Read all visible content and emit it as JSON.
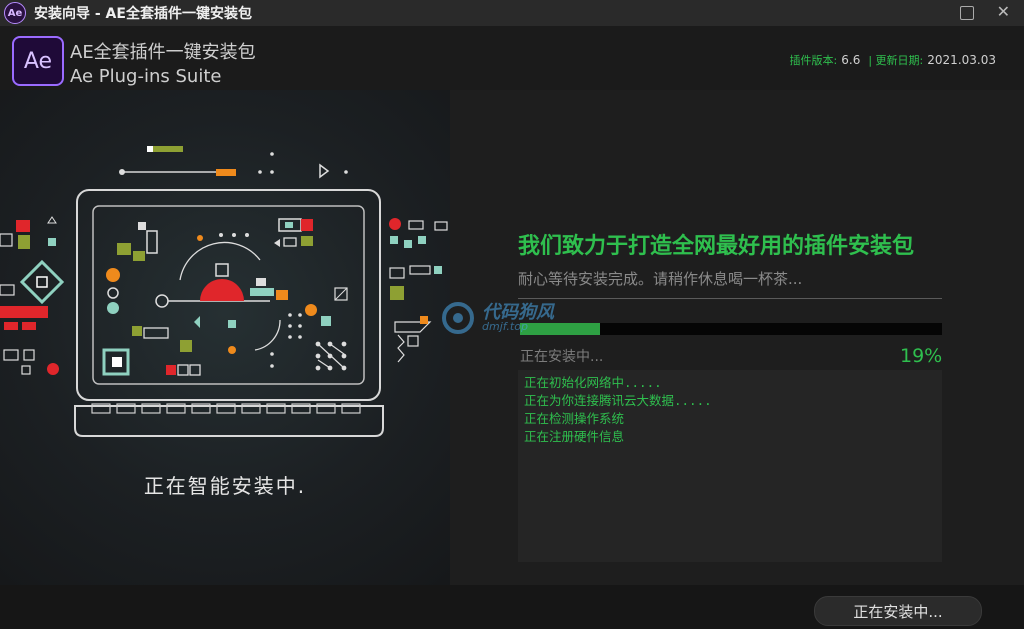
{
  "window": {
    "title": "安装向导 - AE全套插件一键安装包",
    "icon": "Ae"
  },
  "header": {
    "logo_text": "Ae",
    "title": "AE全套插件一键安装包",
    "subtitle": "Ae Plug-ins Suite",
    "version_label": "插件版本:",
    "version_value": "6.6",
    "date_label": "| 更新日期:",
    "date_value": "2021.03.03"
  },
  "illustration": {
    "status_text": "正在智能安装中."
  },
  "main": {
    "tagline": "我们致力于打造全网最好用的插件安装包",
    "subtitle": "耐心等待安装完成。请稍作休息喝一杯茶...",
    "progress": {
      "percent": 19,
      "percent_text": "19%",
      "label": "正在安装中..."
    },
    "log": [
      "正在初始化网络中.....",
      "正在为你连接腾讯云大数据.....",
      "正在检测操作系统",
      "正在注册硬件信息"
    ]
  },
  "watermark": {
    "text": "代码狗风",
    "url": "dmjf.top"
  },
  "footer": {
    "button_label": "正在安装中..."
  },
  "colors": {
    "accent_green": "#2fbf4e",
    "ae_purple": "#9b6bff",
    "illustration_red": "#e0262b"
  }
}
